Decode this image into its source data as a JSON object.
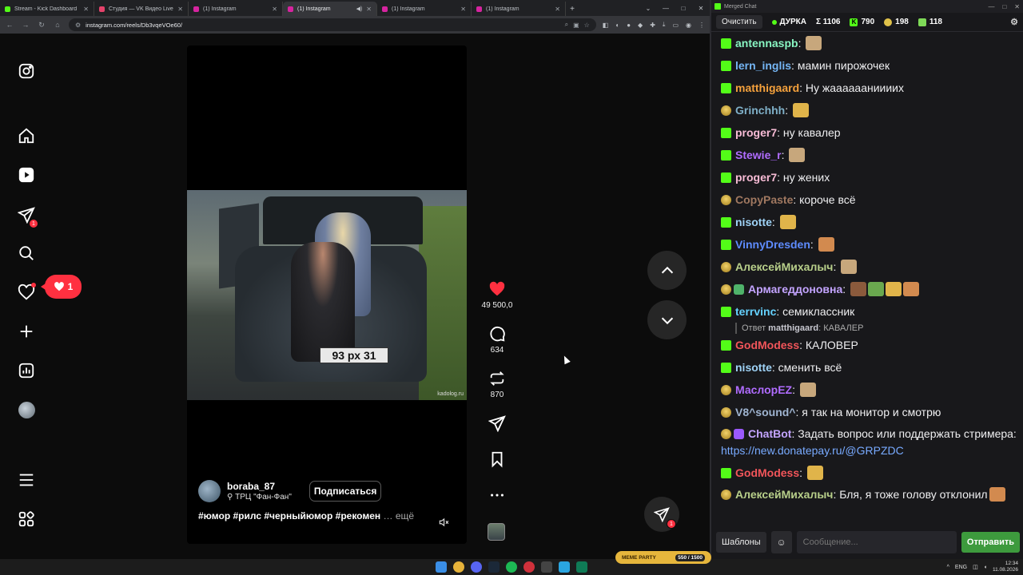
{
  "browser": {
    "tabs": [
      {
        "title": "Stream - Kick Dashboard",
        "color": "#53fc18",
        "active": false
      },
      {
        "title": "Студия — VK Видео Live",
        "color": "#e5426b",
        "active": false
      },
      {
        "title": "(1) Instagram",
        "color": "#d6249f",
        "active": false
      },
      {
        "title": "(1) Instagram",
        "color": "#d6249f",
        "active": true
      },
      {
        "title": "(1) Instagram",
        "color": "#d6249f",
        "active": false
      },
      {
        "title": "(1) Instagram",
        "color": "#d6249f",
        "active": false
      }
    ],
    "url": "instagram.com/reels/Db3vqeVOe60/"
  },
  "instagram": {
    "sidebar": {
      "notifications_badge": "1",
      "messages_badge": "1"
    },
    "notif_bubble": "1",
    "reel": {
      "author": "boraba_87",
      "location": "ТРЦ \"Фан-Фан\"",
      "follow_label": "Подписаться",
      "caption": "#юмор #рилс #черныйюмор #рекомен",
      "more_label": "… ещё",
      "watermark": "kadolog.ru",
      "plate": "93 рх 31",
      "likes": "49 500,0",
      "comments": "634",
      "reposts": "870"
    }
  },
  "chat": {
    "window_title": "Merged Chat",
    "clear_label": "Очистить",
    "channel": "ДУРКА",
    "stats": {
      "total": "Σ 1106",
      "kick": "790",
      "vk": "198",
      "other": "118"
    },
    "messages": [
      {
        "platform": "kick",
        "nick": "antennaspb",
        "color": "#88f5c2",
        "text": "",
        "emotes": 1
      },
      {
        "platform": "kick",
        "nick": "lern_inglis",
        "color": "#75b6f5",
        "text": "мамин пирожочек",
        "emotes": 0
      },
      {
        "platform": "kick",
        "nick": "matthigaard",
        "color": "#f5a13c",
        "text": "Ну жааааааниииих",
        "emotes": 0
      },
      {
        "platform": "vk",
        "nick": "Grinchhh",
        "color": "#7fb0c8",
        "text": "",
        "emotes": 1
      },
      {
        "platform": "kick",
        "nick": "proger7",
        "color": "#f8bcd6",
        "text": "ну кавалер",
        "emotes": 0
      },
      {
        "platform": "kick",
        "nick": "Stewie_r",
        "color": "#b06cff",
        "text": "",
        "emotes": 1
      },
      {
        "platform": "kick",
        "nick": "proger7",
        "color": "#f8bcd6",
        "text": "ну жених",
        "emotes": 0
      },
      {
        "platform": "vk",
        "nick": "CopyPaste",
        "color": "#a07860",
        "text": "короче всё",
        "emotes": 0
      },
      {
        "platform": "kick",
        "nick": "nisotte",
        "color": "#9fd3f7",
        "text": "",
        "emotes": 1
      },
      {
        "platform": "kick",
        "nick": "VinnyDresden",
        "color": "#5e8cff",
        "text": "",
        "emotes": 1
      },
      {
        "platform": "vk",
        "nick": "АлексейМихалыч",
        "color": "#b8cf8a",
        "text": "",
        "emotes": 1
      },
      {
        "platform": "vk",
        "nick": "Армагеддоновна",
        "color": "#c3a4ff",
        "text": "",
        "emotes": 4,
        "shield": true
      },
      {
        "platform": "kick",
        "nick": "terrvinc",
        "color": "#65d2ff",
        "text": "семиклассник",
        "emotes": 0
      },
      {
        "platform": "kick",
        "nick": "GodModess",
        "color": "#f2555a",
        "text": "КАЛОВЕР",
        "emotes": 0,
        "reply_to": "matthigaard",
        "reply_text": "КАВАЛЕР",
        "reply_prefix": "Ответ"
      },
      {
        "platform": "kick",
        "nick": "nisotte",
        "color": "#9fd3f7",
        "text": "сменить всё",
        "emotes": 0
      },
      {
        "platform": "vk",
        "nick": "МаслорEZ",
        "color": "#b06cff",
        "text": "",
        "emotes": 1
      },
      {
        "platform": "vk",
        "nick": "V8^sound^",
        "color": "#9fb4d0",
        "text": "я так на монитор и смотрю",
        "emotes": 0
      },
      {
        "platform": "vk",
        "nick": "ChatBot",
        "color": "#c3a4ff",
        "text": "Задать вопрос или поддержать стримера:",
        "link": "https://new.donatepay.ru/@GRPZDC",
        "emotes": 0,
        "bot": true
      },
      {
        "platform": "kick",
        "nick": "GodModess",
        "color": "#f2555a",
        "text": "",
        "emotes": 1
      },
      {
        "platform": "vk",
        "nick": "АлексейМихалыч",
        "color": "#b8cf8a",
        "text": "Бля, я тоже голову отклонил",
        "emotes": 1,
        "multi": true
      }
    ],
    "templates_label": "Шаблоны",
    "input_placeholder": "Сообщение...",
    "send_label": "Отправить"
  },
  "taskbar": {
    "lang": "ENG",
    "time": "12:34",
    "date": "11.08.2026",
    "meme_widget": {
      "label": "MEME PARTY",
      "progress": "550 / 1500"
    }
  }
}
